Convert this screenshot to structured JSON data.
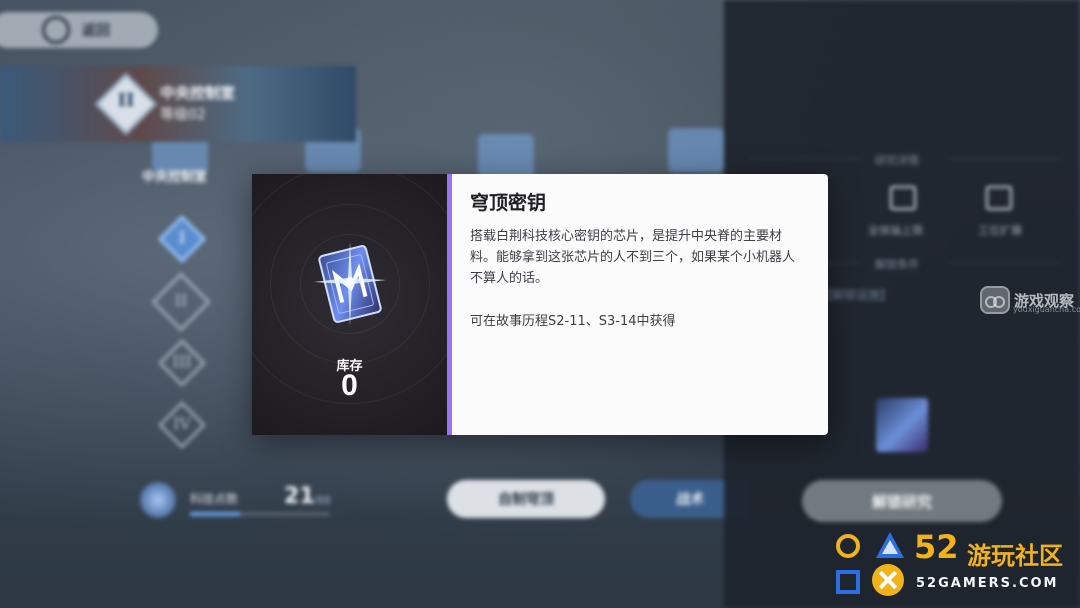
{
  "background": {
    "back_button": {
      "label": "返回"
    },
    "categories": [
      {
        "label": "中央控制室",
        "icon": "server-icon"
      },
      {
        "label": "",
        "icon": "network-icon"
      },
      {
        "label": "",
        "icon": "dumbbell-icon"
      },
      {
        "label": "",
        "icon": "tools-icon"
      }
    ],
    "tiers": [
      "I",
      "II",
      "III",
      "IV"
    ],
    "tech_points": {
      "label": "科技点数",
      "value": "21",
      "max": "/88",
      "progress": 0.36
    },
    "buttons": {
      "self_build": "自制穹顶",
      "battle": "战术"
    }
  },
  "side_panel": {
    "facility_title": "中央控制室",
    "facility_level": "等级02",
    "tier_badge": "II",
    "section_details": "研究详情",
    "effects": [
      {
        "label": "全体抽上限",
        "icon": "upgrade-icon"
      },
      {
        "label": "工位扩展",
        "icon": "grid-icon"
      }
    ],
    "section_unlock": "解锁条件",
    "unlock_link": "【解锁设施】",
    "unlock_button": "解锁研究"
  },
  "modal": {
    "item_name": "穹顶密钥",
    "description": "搭载白荆科技核心密钥的芯片，是提升中央脊的主要材料。能够拿到这张芯片的人不到三个，如果某个小机器人不算人的话。",
    "source": "可在故事历程S2-11、S3-14中获得",
    "stock_label": "库存",
    "stock_value": "0",
    "accent_color": "#9b74f2"
  },
  "watermarks": {
    "site1_name": "游戏观察",
    "site1_domain": "youxiguancha.com",
    "site2_number": "52",
    "site2_name": "游玩社区",
    "site2_domain": "52GAMERS.COM"
  }
}
